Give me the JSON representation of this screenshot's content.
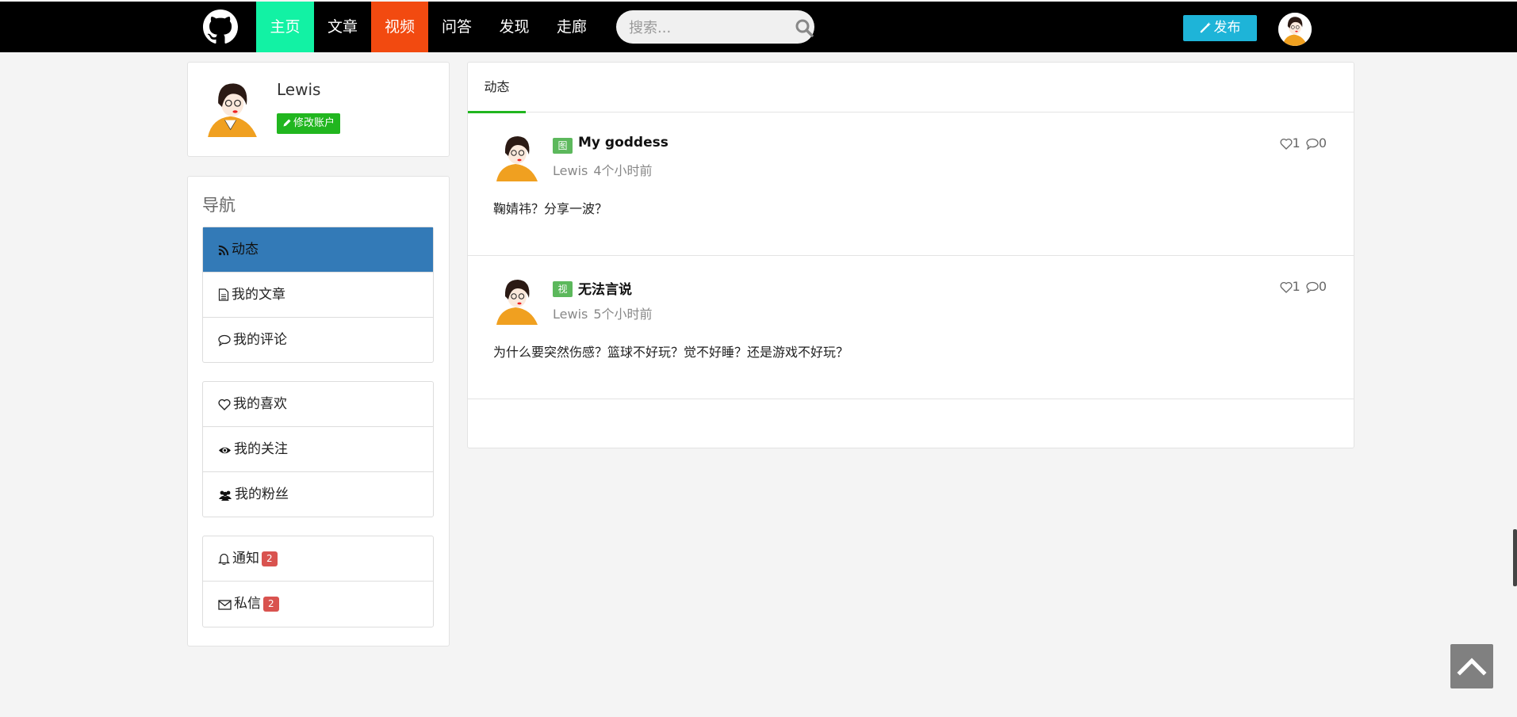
{
  "navbar": {
    "brand_icon": "github-icon",
    "items": [
      {
        "label": "主页",
        "color": "#12f2a4"
      },
      {
        "label": "文章"
      },
      {
        "label": "视频",
        "color": "#f24a10"
      },
      {
        "label": "问答"
      },
      {
        "label": "发现"
      },
      {
        "label": "走廊"
      }
    ],
    "search_placeholder": "搜索...",
    "publish_label": "发布",
    "publish_color": "#1eb4d8"
  },
  "profile": {
    "name": "Lewis",
    "edit_label": "修改账户",
    "edit_color": "#21b61f"
  },
  "sidebar": {
    "title": "导航",
    "groups": [
      [
        {
          "label": "动态",
          "icon": "rss-icon",
          "active": true
        },
        {
          "label": "我的文章",
          "icon": "document-icon"
        },
        {
          "label": "我的评论",
          "icon": "comment-icon"
        }
      ],
      [
        {
          "label": "我的喜欢",
          "icon": "heart-icon"
        },
        {
          "label": "我的关注",
          "icon": "eye-icon"
        },
        {
          "label": "我的粉丝",
          "icon": "users-icon"
        }
      ],
      [
        {
          "label": "通知",
          "icon": "bell-icon",
          "badge": "2"
        },
        {
          "label": "私信",
          "icon": "envelope-icon",
          "badge": "2"
        }
      ]
    ],
    "active_color": "#337ab7",
    "badge_color": "#d9534f"
  },
  "feed": {
    "tab_label": "动态",
    "posts": [
      {
        "type": "图",
        "title": "My goddess",
        "author": "Lewis",
        "time": "4个小时前",
        "body": "鞠婧祎？分享一波？",
        "likes": "1",
        "comments": "0"
      },
      {
        "type": "视",
        "title": "无法言说",
        "author": "Lewis",
        "time": "5个小时前",
        "body": "为什么要突然伤感？篮球不好玩？觉不好睡？还是游戏不好玩？",
        "likes": "1",
        "comments": "0"
      }
    ]
  }
}
